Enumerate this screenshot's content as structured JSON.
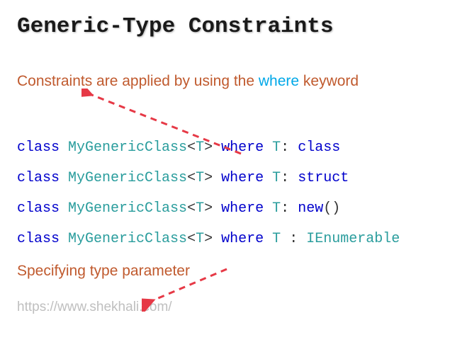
{
  "title": "Generic-Type Constraints",
  "subtitle1_prefix": "Constraints are applied by using the ",
  "subtitle1_where": "where",
  "subtitle1_suffix": " keyword",
  "code": {
    "lines": [
      {
        "kw": "class",
        "name": "MyGenericClass",
        "tp": "T",
        "where": "where",
        "tvar": "T",
        "constraint_kw": "class",
        "constraint_iface": ""
      },
      {
        "kw": "class",
        "name": "MyGenericClass",
        "tp": "T",
        "where": "where",
        "tvar": "T",
        "constraint_kw": "struct",
        "constraint_iface": ""
      },
      {
        "kw": "class",
        "name": "MyGenericClass",
        "tp": "T",
        "where": "where",
        "tvar": "T",
        "constraint_kw": "new",
        "constraint_iface": "",
        "has_parens": true
      },
      {
        "kw": "class",
        "name": "MyGenericClass",
        "tp": "T",
        "where": "where",
        "tvar": "T",
        "constraint_kw": "",
        "constraint_iface": "IEnumerable",
        "space_colon": true
      }
    ]
  },
  "subtitle2": "Specifying type parameter",
  "footer_url": "https://www.shekhali.com/",
  "colors": {
    "accent_orange": "#c05a2e",
    "accent_blue": "#00a8e8",
    "keyword_blue": "#0000cc",
    "type_teal": "#2a9d9d",
    "arrow_red": "#e63946"
  }
}
